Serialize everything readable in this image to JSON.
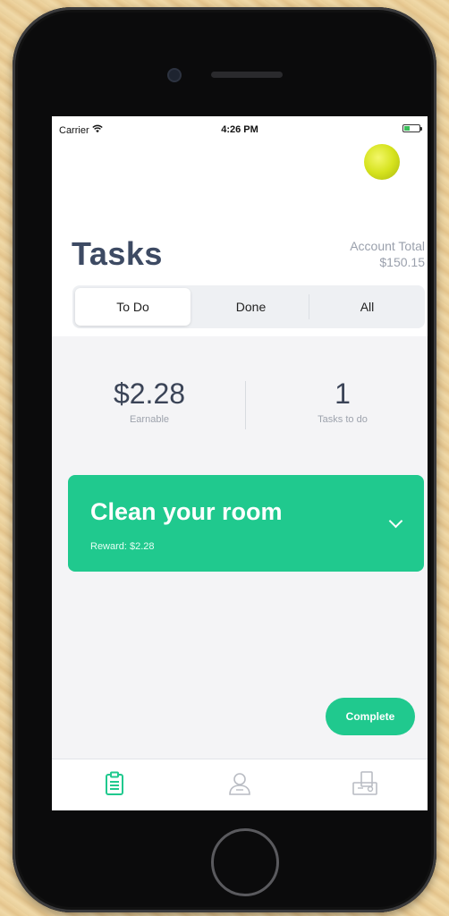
{
  "status_bar": {
    "carrier": "Carrier",
    "time": "4:26 PM"
  },
  "header": {
    "title": "Tasks",
    "account_total_label": "Account Total",
    "account_total_value": "$150.15"
  },
  "segments": [
    {
      "label": "To Do",
      "active": true
    },
    {
      "label": "Done",
      "active": false
    },
    {
      "label": "All",
      "active": false
    }
  ],
  "stats": {
    "earnable_value": "$2.28",
    "earnable_label": "Earnable",
    "tasks_value": "1",
    "tasks_label": "Tasks to do"
  },
  "tasks": [
    {
      "title": "Clean your room",
      "reward": "Reward: $2.28"
    }
  ],
  "actions": {
    "complete_label": "Complete"
  },
  "tab_bar": [
    {
      "icon": "clipboard-icon",
      "active": true
    },
    {
      "icon": "person-icon",
      "active": false
    },
    {
      "icon": "store-icon",
      "active": false
    }
  ],
  "colors": {
    "accent": "#20c98e",
    "title": "#3d4a63",
    "avatar": "#d6e31e"
  }
}
